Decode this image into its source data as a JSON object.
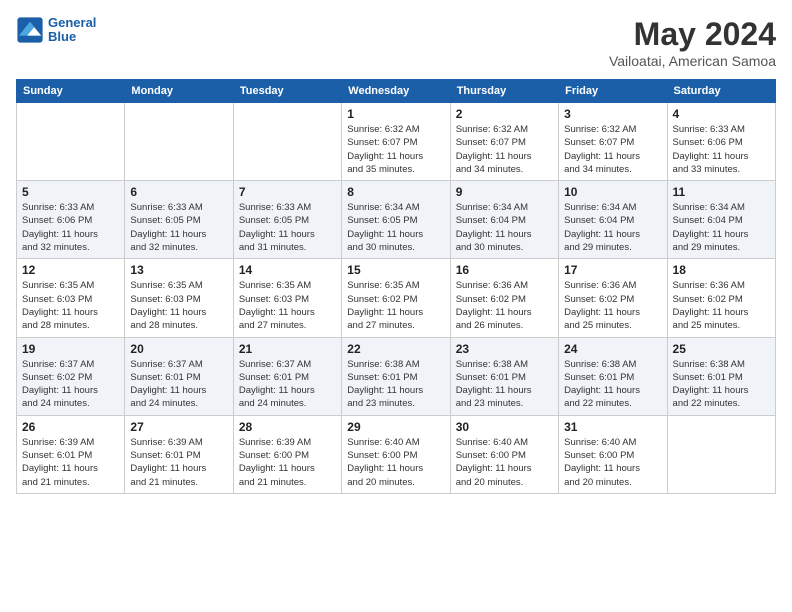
{
  "header": {
    "logo_line1": "General",
    "logo_line2": "Blue",
    "title": "May 2024",
    "subtitle": "Vailoatai, American Samoa"
  },
  "weekdays": [
    "Sunday",
    "Monday",
    "Tuesday",
    "Wednesday",
    "Thursday",
    "Friday",
    "Saturday"
  ],
  "weeks": [
    [
      {
        "day": "",
        "content": ""
      },
      {
        "day": "",
        "content": ""
      },
      {
        "day": "",
        "content": ""
      },
      {
        "day": "1",
        "content": "Sunrise: 6:32 AM\nSunset: 6:07 PM\nDaylight: 11 hours\nand 35 minutes."
      },
      {
        "day": "2",
        "content": "Sunrise: 6:32 AM\nSunset: 6:07 PM\nDaylight: 11 hours\nand 34 minutes."
      },
      {
        "day": "3",
        "content": "Sunrise: 6:32 AM\nSunset: 6:07 PM\nDaylight: 11 hours\nand 34 minutes."
      },
      {
        "day": "4",
        "content": "Sunrise: 6:33 AM\nSunset: 6:06 PM\nDaylight: 11 hours\nand 33 minutes."
      }
    ],
    [
      {
        "day": "5",
        "content": "Sunrise: 6:33 AM\nSunset: 6:06 PM\nDaylight: 11 hours\nand 32 minutes."
      },
      {
        "day": "6",
        "content": "Sunrise: 6:33 AM\nSunset: 6:05 PM\nDaylight: 11 hours\nand 32 minutes."
      },
      {
        "day": "7",
        "content": "Sunrise: 6:33 AM\nSunset: 6:05 PM\nDaylight: 11 hours\nand 31 minutes."
      },
      {
        "day": "8",
        "content": "Sunrise: 6:34 AM\nSunset: 6:05 PM\nDaylight: 11 hours\nand 30 minutes."
      },
      {
        "day": "9",
        "content": "Sunrise: 6:34 AM\nSunset: 6:04 PM\nDaylight: 11 hours\nand 30 minutes."
      },
      {
        "day": "10",
        "content": "Sunrise: 6:34 AM\nSunset: 6:04 PM\nDaylight: 11 hours\nand 29 minutes."
      },
      {
        "day": "11",
        "content": "Sunrise: 6:34 AM\nSunset: 6:04 PM\nDaylight: 11 hours\nand 29 minutes."
      }
    ],
    [
      {
        "day": "12",
        "content": "Sunrise: 6:35 AM\nSunset: 6:03 PM\nDaylight: 11 hours\nand 28 minutes."
      },
      {
        "day": "13",
        "content": "Sunrise: 6:35 AM\nSunset: 6:03 PM\nDaylight: 11 hours\nand 28 minutes."
      },
      {
        "day": "14",
        "content": "Sunrise: 6:35 AM\nSunset: 6:03 PM\nDaylight: 11 hours\nand 27 minutes."
      },
      {
        "day": "15",
        "content": "Sunrise: 6:35 AM\nSunset: 6:02 PM\nDaylight: 11 hours\nand 27 minutes."
      },
      {
        "day": "16",
        "content": "Sunrise: 6:36 AM\nSunset: 6:02 PM\nDaylight: 11 hours\nand 26 minutes."
      },
      {
        "day": "17",
        "content": "Sunrise: 6:36 AM\nSunset: 6:02 PM\nDaylight: 11 hours\nand 25 minutes."
      },
      {
        "day": "18",
        "content": "Sunrise: 6:36 AM\nSunset: 6:02 PM\nDaylight: 11 hours\nand 25 minutes."
      }
    ],
    [
      {
        "day": "19",
        "content": "Sunrise: 6:37 AM\nSunset: 6:02 PM\nDaylight: 11 hours\nand 24 minutes."
      },
      {
        "day": "20",
        "content": "Sunrise: 6:37 AM\nSunset: 6:01 PM\nDaylight: 11 hours\nand 24 minutes."
      },
      {
        "day": "21",
        "content": "Sunrise: 6:37 AM\nSunset: 6:01 PM\nDaylight: 11 hours\nand 24 minutes."
      },
      {
        "day": "22",
        "content": "Sunrise: 6:38 AM\nSunset: 6:01 PM\nDaylight: 11 hours\nand 23 minutes."
      },
      {
        "day": "23",
        "content": "Sunrise: 6:38 AM\nSunset: 6:01 PM\nDaylight: 11 hours\nand 23 minutes."
      },
      {
        "day": "24",
        "content": "Sunrise: 6:38 AM\nSunset: 6:01 PM\nDaylight: 11 hours\nand 22 minutes."
      },
      {
        "day": "25",
        "content": "Sunrise: 6:38 AM\nSunset: 6:01 PM\nDaylight: 11 hours\nand 22 minutes."
      }
    ],
    [
      {
        "day": "26",
        "content": "Sunrise: 6:39 AM\nSunset: 6:01 PM\nDaylight: 11 hours\nand 21 minutes."
      },
      {
        "day": "27",
        "content": "Sunrise: 6:39 AM\nSunset: 6:01 PM\nDaylight: 11 hours\nand 21 minutes."
      },
      {
        "day": "28",
        "content": "Sunrise: 6:39 AM\nSunset: 6:00 PM\nDaylight: 11 hours\nand 21 minutes."
      },
      {
        "day": "29",
        "content": "Sunrise: 6:40 AM\nSunset: 6:00 PM\nDaylight: 11 hours\nand 20 minutes."
      },
      {
        "day": "30",
        "content": "Sunrise: 6:40 AM\nSunset: 6:00 PM\nDaylight: 11 hours\nand 20 minutes."
      },
      {
        "day": "31",
        "content": "Sunrise: 6:40 AM\nSunset: 6:00 PM\nDaylight: 11 hours\nand 20 minutes."
      },
      {
        "day": "",
        "content": ""
      }
    ]
  ]
}
